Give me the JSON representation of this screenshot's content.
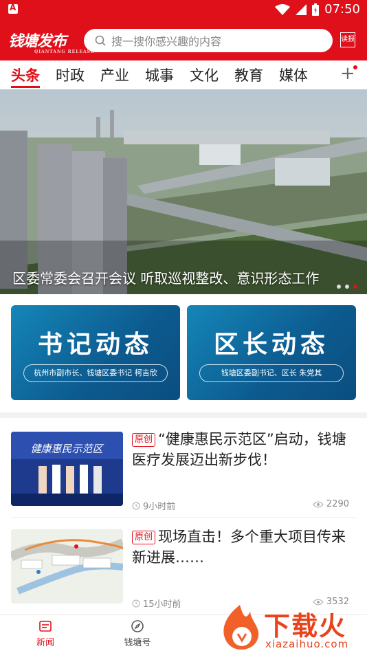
{
  "status": {
    "time": "07:50"
  },
  "header": {
    "logo_text": "钱塘发布",
    "logo_sub": "QIANTANG RELEASE",
    "search_placeholder": "搜一搜你感兴趣的内容",
    "read_label": "读报"
  },
  "tabs": [
    {
      "label": "头条",
      "active": true
    },
    {
      "label": "时政"
    },
    {
      "label": "产业"
    },
    {
      "label": "城事"
    },
    {
      "label": "文化"
    },
    {
      "label": "教育"
    },
    {
      "label": "媒体"
    }
  ],
  "banner": {
    "caption": "区委常委会召开会议  听取巡视整改、意识形态工作",
    "slide_count": 3,
    "active_slide": 3
  },
  "cards": [
    {
      "title": "书记动态",
      "subtitle": "杭州市副市长、钱塘区委书记  柯吉欣"
    },
    {
      "title": "区长动态",
      "subtitle": "钱塘区委副书记、区长  朱党其"
    }
  ],
  "news": [
    {
      "tag": "原创",
      "title": "“健康惠民示范区”启动，钱塘医疗发展迈出新步伐！",
      "time": "9小时前",
      "views": "2290",
      "thumb_text": "健康惠民示范区"
    },
    {
      "tag": "原创",
      "title": "现场直击！多个重大项目传来新进展……",
      "time": "15小时前",
      "views": "3532"
    }
  ],
  "bottom_nav": [
    {
      "label": "新闻",
      "active": true
    },
    {
      "label": "钱塘号"
    }
  ],
  "watermark": {
    "text": "下载火",
    "url": "xiazaihuo.com"
  },
  "colors": {
    "brand_red": "#e0101b",
    "card_blue": "#0c5a8f"
  }
}
